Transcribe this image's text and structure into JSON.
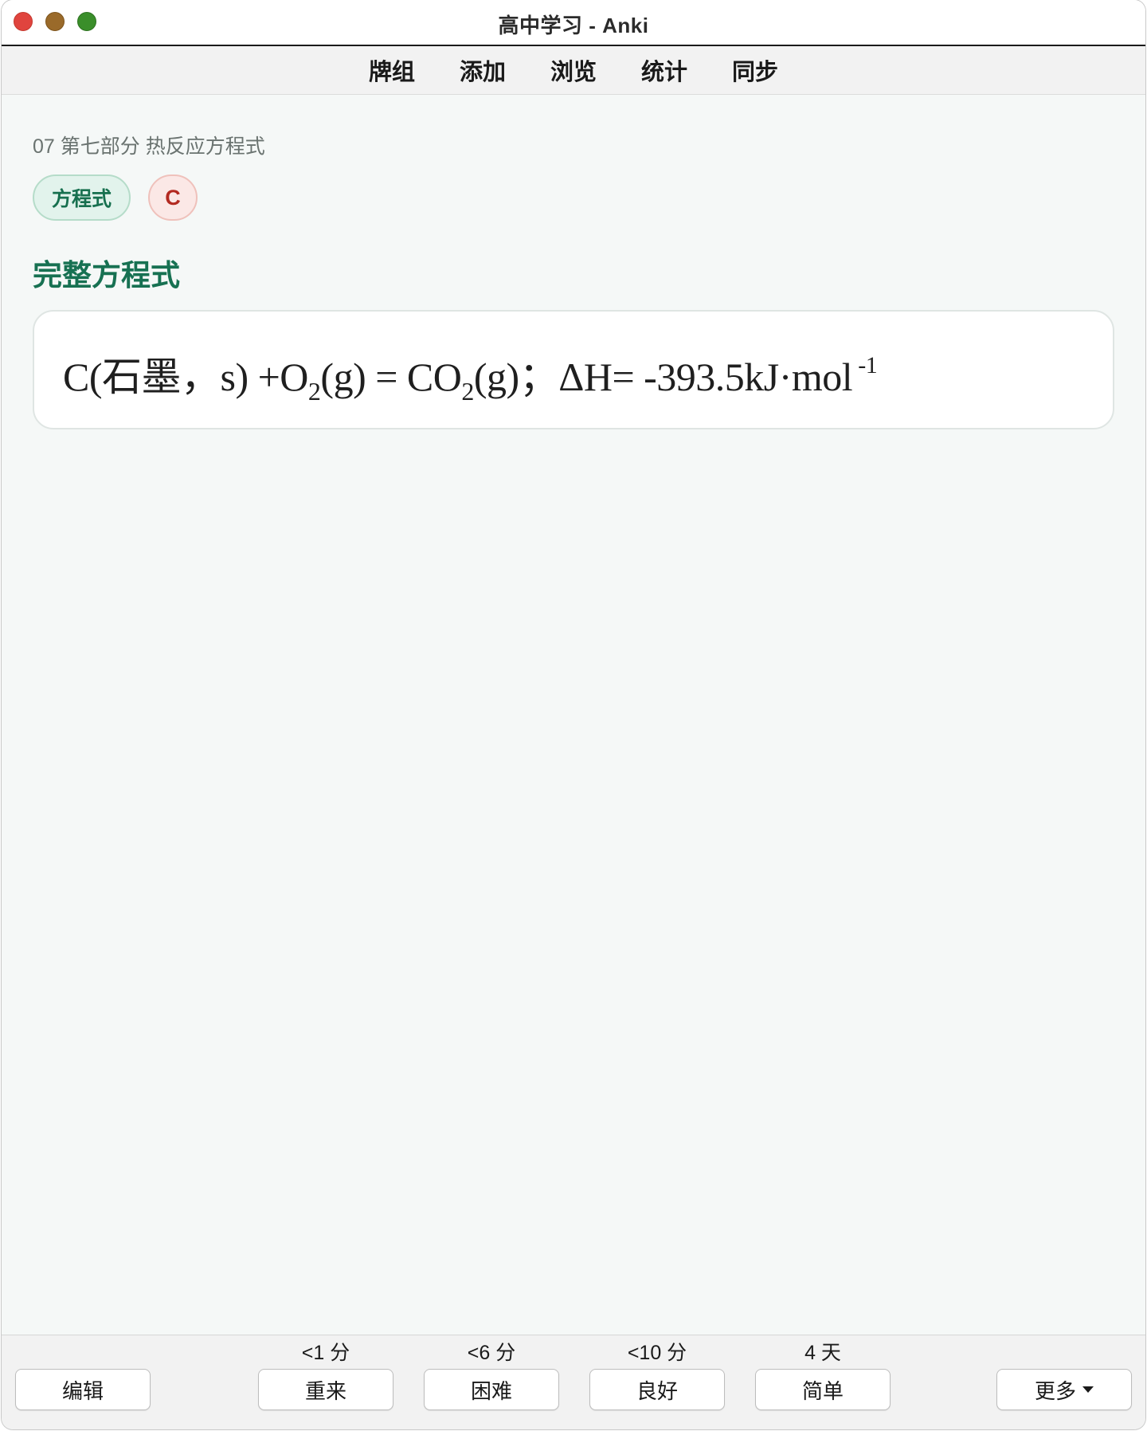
{
  "window": {
    "title": "高中学习 - Anki"
  },
  "toolbar": {
    "items": [
      {
        "label": "牌组"
      },
      {
        "label": "添加"
      },
      {
        "label": "浏览"
      },
      {
        "label": "统计"
      },
      {
        "label": "同步"
      }
    ]
  },
  "card": {
    "deck_path": "07 第七部分 热反应方程式",
    "tags": [
      "方程式",
      "C"
    ],
    "section_title": "完整方程式",
    "equation": {
      "p1": "C(石墨，s) +O",
      "sub1": "2",
      "p2": "(g)  = CO",
      "sub2": "2",
      "p3": "(g)；ΔH= -393.5kJ·mol",
      "sup": " -1"
    }
  },
  "answer_bar": {
    "edit_label": "编辑",
    "more_label": "更多",
    "buttons": [
      {
        "label": "重来",
        "interval": "<1 分"
      },
      {
        "label": "困难",
        "interval": "<6 分"
      },
      {
        "label": "良好",
        "interval": "<10 分"
      },
      {
        "label": "简单",
        "interval": "4 天"
      }
    ]
  },
  "colors": {
    "accent_green": "#177152",
    "tag_red": "#b32a21",
    "close": "#e0443e",
    "minimize": "#9a6a2a",
    "zoom": "#3a8e2a"
  }
}
